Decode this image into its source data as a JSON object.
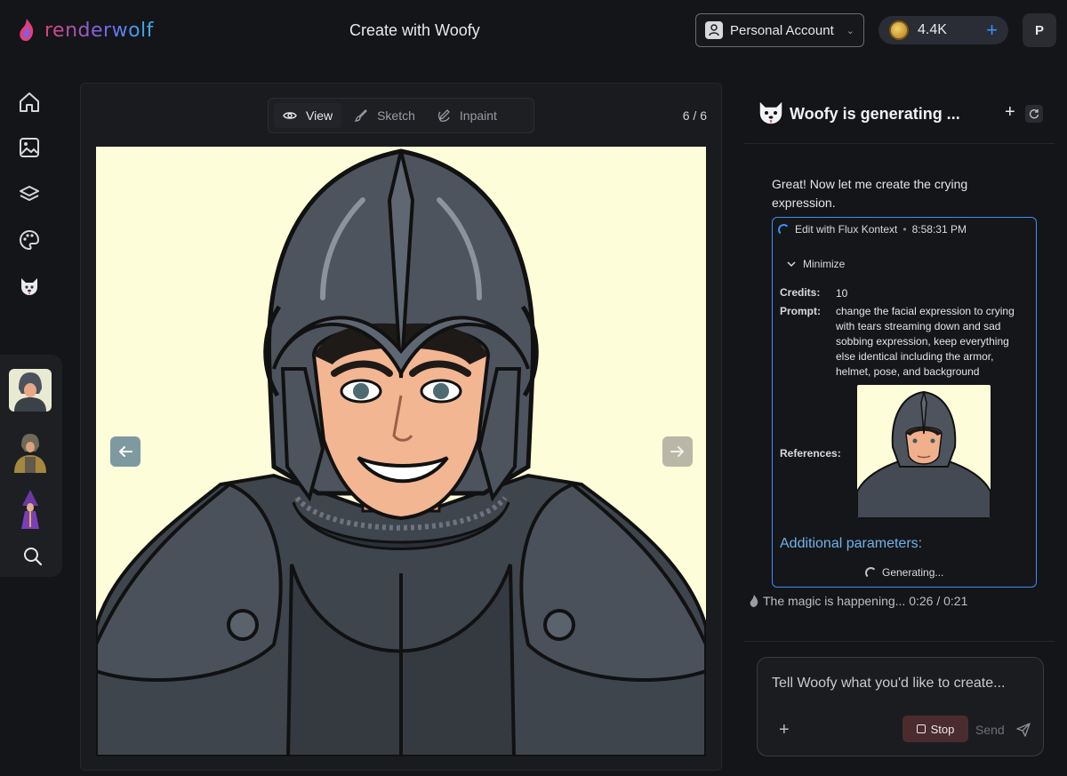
{
  "app": {
    "brand": "renderwolf",
    "page_title": "Create with Woofy"
  },
  "header": {
    "account_label": "Personal Account",
    "credits": "4.4K",
    "avatar_initial": "P"
  },
  "nav": {
    "items": [
      "home-icon",
      "gallery-icon",
      "layers-icon",
      "palette-icon",
      "woofy-icon"
    ]
  },
  "history": {
    "items": [
      "knight-smiling",
      "knight-gold",
      "wizard-purple"
    ],
    "search_icon": "search-icon"
  },
  "canvas": {
    "modes": [
      {
        "label": "View",
        "icon": "eye-icon",
        "active": true
      },
      {
        "label": "Sketch",
        "icon": "brush-icon",
        "active": false
      },
      {
        "label": "Inpaint",
        "icon": "inpaint-icon",
        "active": false
      }
    ],
    "counter": "6 / 6"
  },
  "chat": {
    "title": "Woofy is generating ...",
    "message": "Great! Now let me create the crying expression.",
    "tool": {
      "name": "Edit with Flux Kontext",
      "time": "8:58:31 PM",
      "minimize_label": "Minimize",
      "credits_label": "Credits:",
      "credits_value": "10",
      "prompt_label": "Prompt:",
      "prompt_value": "change the facial expression to crying with tears streaming down and sad sobbing expression, keep everything else identical including the armor, helmet, pose, and background",
      "references_label": "References:",
      "additional_params": "Additional parameters:",
      "status": "Generating..."
    },
    "progress_text": "The magic is happening... 0:26 / 0:21",
    "composer": {
      "placeholder": "Tell Woofy what you'd like to create...",
      "stop_label": "Stop",
      "send_label": "Send"
    }
  }
}
